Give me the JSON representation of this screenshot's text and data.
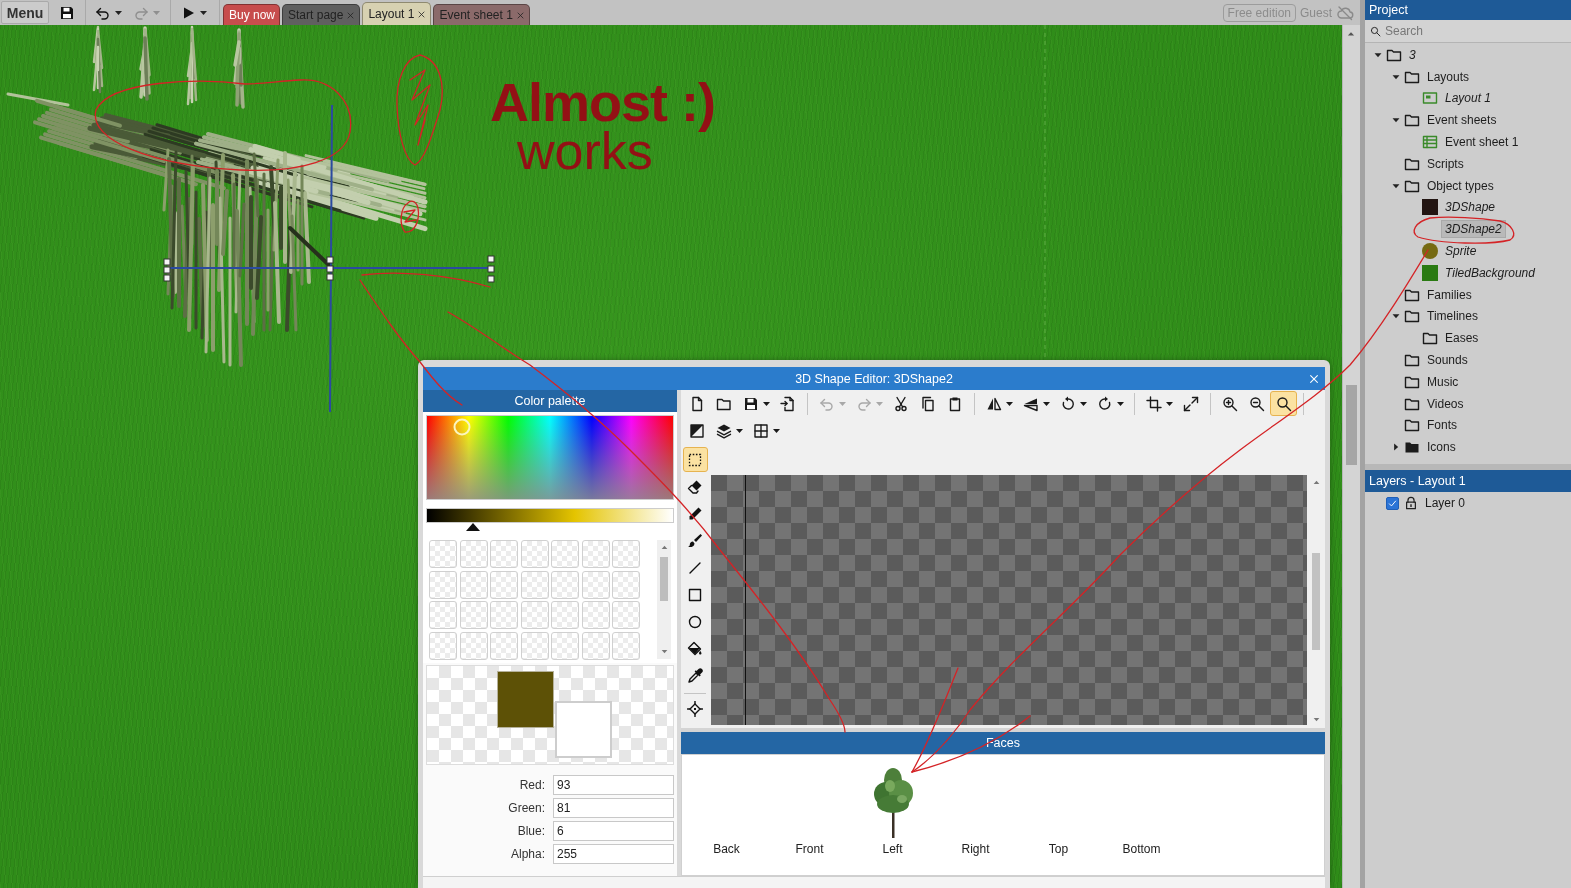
{
  "top_bar": {
    "menu": "Menu",
    "undo": {
      "disabled": false
    },
    "redo": {
      "disabled": true
    },
    "tabs": [
      {
        "label": "Buy now",
        "kind": "promo",
        "color": "#c74d4d",
        "selected": false,
        "closable": false
      },
      {
        "label": "Start page",
        "kind": "page",
        "color": "#606060",
        "selected": false,
        "closable": true
      },
      {
        "label": "Layout 1",
        "kind": "page",
        "color": "#d7d1b1",
        "selected": true,
        "closable": true
      },
      {
        "label": "Event sheet 1",
        "kind": "page",
        "color": "#8b6a6a",
        "selected": false,
        "closable": true
      }
    ],
    "badge": "Free edition",
    "user": "Guest"
  },
  "layout_canvas": {
    "annotations": [
      {
        "text": "Almost :)",
        "kind": "bold"
      },
      {
        "text": "works",
        "kind": "regular"
      }
    ]
  },
  "shape_editor": {
    "title": "3D Shape Editor: 3DShape2",
    "color_palette": {
      "title": "Color palette",
      "brightness": {
        "level": 0.19
      },
      "colors": [
        {
          "color": "#5d5106"
        },
        {
          "color": "#ffffff"
        }
      ],
      "channels": [
        {
          "label": "Red:",
          "value": "93"
        },
        {
          "label": "Green:",
          "value": "81"
        },
        {
          "label": "Blue:",
          "value": "6"
        },
        {
          "label": "Alpha:",
          "value": "255"
        }
      ]
    },
    "toolbar": [
      [
        {
          "kind": "new",
          "dropdown": false,
          "disabled": false,
          "selected": false
        },
        {
          "kind": "open",
          "dropdown": false,
          "disabled": false,
          "selected": false
        },
        {
          "kind": "save",
          "dropdown": true,
          "disabled": false,
          "selected": false
        },
        {
          "kind": "export",
          "dropdown": false,
          "disabled": false,
          "selected": false
        },
        {
          "kind": "separator"
        },
        {
          "kind": "undo",
          "dropdown": true,
          "disabled": true,
          "selected": false
        },
        {
          "kind": "redo",
          "dropdown": true,
          "disabled": true,
          "selected": false
        },
        {
          "kind": "cut",
          "dropdown": false,
          "disabled": false,
          "selected": false
        },
        {
          "kind": "copy",
          "dropdown": false,
          "disabled": false,
          "selected": false
        },
        {
          "kind": "paste",
          "dropdown": false,
          "disabled": false,
          "selected": false
        },
        {
          "kind": "separator"
        },
        {
          "kind": "flip_h",
          "dropdown": true,
          "disabled": false,
          "selected": false
        },
        {
          "kind": "flip_v",
          "dropdown": true,
          "disabled": false,
          "selected": false
        },
        {
          "kind": "rotate_ccw",
          "dropdown": true,
          "disabled": false,
          "selected": false
        },
        {
          "kind": "rotate_cw",
          "dropdown": true,
          "disabled": false,
          "selected": false
        },
        {
          "kind": "separator"
        },
        {
          "kind": "crop",
          "dropdown": true,
          "disabled": false,
          "selected": false
        },
        {
          "kind": "resize",
          "dropdown": false,
          "disabled": false,
          "selected": false
        },
        {
          "kind": "separator"
        },
        {
          "kind": "zoom_in",
          "dropdown": false,
          "disabled": false,
          "selected": false
        },
        {
          "kind": "zoom_out",
          "dropdown": false,
          "disabled": false,
          "selected": false
        },
        {
          "kind": "zoom_fit",
          "dropdown": false,
          "disabled": false,
          "selected": true
        },
        {
          "kind": "separator"
        }
      ],
      [
        {
          "kind": "invert",
          "dropdown": false,
          "disabled": false,
          "selected": false
        },
        {
          "kind": "layers",
          "dropdown": true,
          "disabled": false,
          "selected": false
        },
        {
          "kind": "grid",
          "dropdown": true,
          "disabled": false,
          "selected": false
        }
      ]
    ],
    "tools": [
      {
        "kind": "select",
        "selected": true
      },
      {
        "kind": "eraser",
        "selected": false
      },
      {
        "kind": "pencil",
        "selected": false
      },
      {
        "kind": "brush",
        "selected": false
      },
      {
        "kind": "line",
        "selected": false
      },
      {
        "kind": "rectangle",
        "selected": false
      },
      {
        "kind": "ellipse",
        "selected": false
      },
      {
        "kind": "fill",
        "selected": false
      },
      {
        "kind": "eyedropper",
        "selected": false
      },
      {
        "kind": "separator"
      },
      {
        "kind": "hotspot",
        "selected": false
      }
    ],
    "faces": {
      "title": "Faces",
      "items": [
        {
          "label": "Back",
          "has_image": false
        },
        {
          "label": "Front",
          "has_image": false
        },
        {
          "label": "Left",
          "has_image": true
        },
        {
          "label": "Right",
          "has_image": false
        },
        {
          "label": "Top",
          "has_image": false
        },
        {
          "label": "Bottom",
          "has_image": false
        }
      ]
    }
  },
  "project": {
    "title": "Project",
    "search": {
      "placeholder": "Search"
    },
    "tree": [
      {
        "label": "3",
        "kind": "project",
        "expanded": true,
        "selected": false,
        "children": [
          {
            "label": "Layouts",
            "kind": "folder",
            "expanded": true,
            "selected": false,
            "children": [
              {
                "label": "Layout 1",
                "kind": "layout",
                "selected": false
              }
            ]
          },
          {
            "label": "Event sheets",
            "kind": "folder",
            "expanded": true,
            "selected": false,
            "children": [
              {
                "label": "Event sheet 1",
                "kind": "event_sheet",
                "selected": false
              }
            ]
          },
          {
            "label": "Scripts",
            "kind": "folder",
            "selected": false
          },
          {
            "label": "Object types",
            "kind": "folder",
            "expanded": true,
            "selected": false,
            "children": [
              {
                "label": "3DShape",
                "kind": "shape3d",
                "color": "#221512",
                "selected": false
              },
              {
                "label": "3DShape2",
                "kind": "shape3d",
                "selected": true
              },
              {
                "label": "Sprite",
                "kind": "sprite",
                "color": "#766a12",
                "selected": false
              },
              {
                "label": "TiledBackground",
                "kind": "tiled_background",
                "color": "#2a7a12",
                "selected": false
              }
            ]
          },
          {
            "label": "Families",
            "kind": "folder",
            "selected": false
          },
          {
            "label": "Timelines",
            "kind": "folder",
            "expanded": true,
            "selected": false,
            "children": [
              {
                "label": "Eases",
                "kind": "folder",
                "selected": false
              }
            ]
          },
          {
            "label": "Sounds",
            "kind": "folder",
            "selected": false
          },
          {
            "label": "Music",
            "kind": "folder",
            "selected": false
          },
          {
            "label": "Videos",
            "kind": "folder",
            "selected": false
          },
          {
            "label": "Fonts",
            "kind": "folder",
            "selected": false
          },
          {
            "label": "Icons",
            "kind": "special_folder",
            "expanded": false,
            "selected": false
          }
        ]
      }
    ]
  },
  "layers": {
    "title": "Layers - Layout 1",
    "items": [
      {
        "label": "Layer 0",
        "visible": true
      }
    ]
  }
}
